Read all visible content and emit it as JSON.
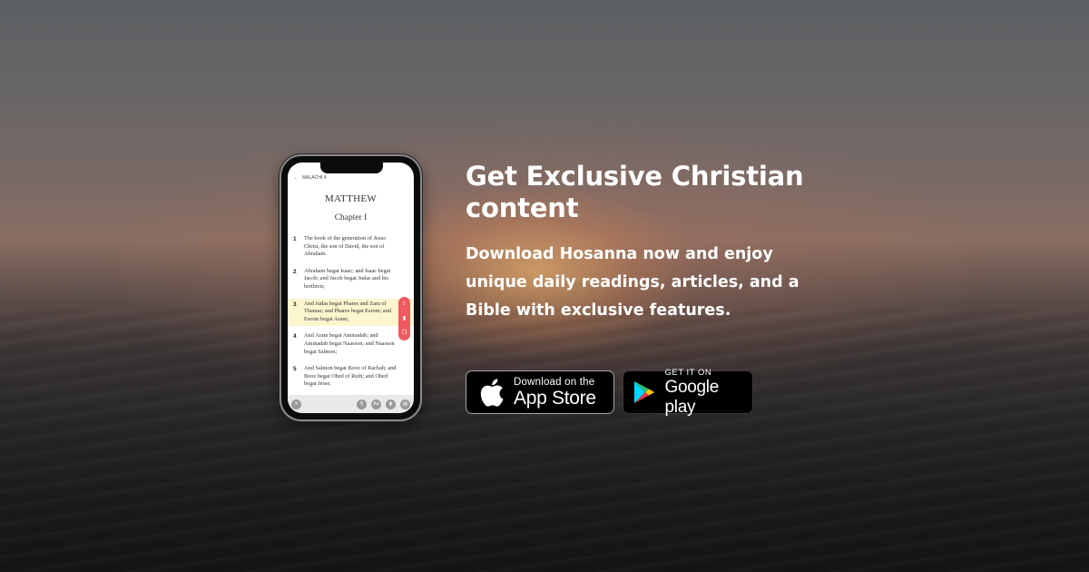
{
  "phone": {
    "back_label": "MALACHI 4",
    "book": "MATTHEW",
    "chapter": "Chapter I",
    "verses": [
      {
        "n": "1",
        "text": "The book of the generation of Jesus Christ, the son of David, the son of Abraham."
      },
      {
        "n": "2",
        "text": "Abraham begat Isaac; and Isaac begat Jacob; and Jacob begat Judas and his brethren;"
      },
      {
        "n": "3",
        "text": "And Judas begat Phares and Zara of Thamar; and Phares begat Esrom; and Esrom begat Aram;"
      },
      {
        "n": "4",
        "text": "And Aram begat Aminadab; and Aminadab begat Naasson; and Naasson begat Salmon;"
      },
      {
        "n": "5",
        "text": "And Salmon begat Booz of Rachab; and Booz begat Obed of Ruth; and Obed begat Jesse;"
      }
    ],
    "highlighted_verse": "3",
    "toolbar": {
      "aa": "Aa"
    }
  },
  "headline": "Get Exclusive Christian content",
  "subheadline": "Download Hosanna now and enjoy unique daily readings, articles, and a Bible with exclusive features.",
  "app_store": {
    "small": "Download on the",
    "big": "App Store",
    "icon": "apple-icon"
  },
  "google_play": {
    "small": "GET IT ON",
    "big": "Google play",
    "icon": "google-play-icon"
  },
  "colors": {
    "accent_action": "#f05a5f",
    "highlight": "#fcf6cf",
    "text": "#ffffff"
  }
}
